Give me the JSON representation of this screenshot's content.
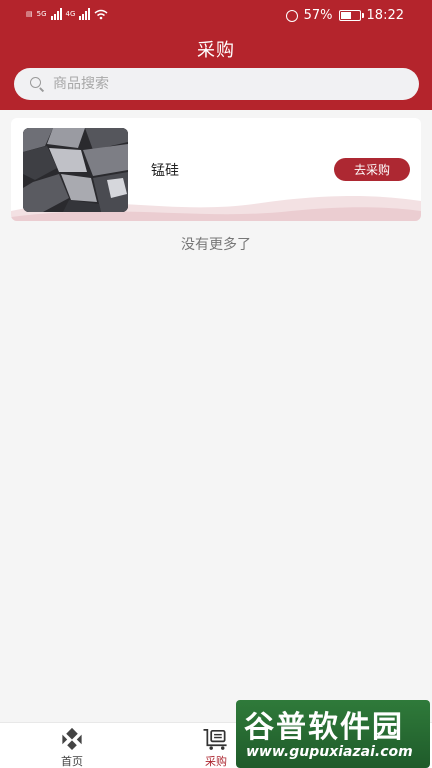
{
  "status_bar": {
    "network_tags": [
      "5G",
      "4G"
    ],
    "battery_percent": "57%",
    "battery_level": 0.57,
    "time": "18:22"
  },
  "header": {
    "title": "采购"
  },
  "search": {
    "placeholder": "商品搜索",
    "value": ""
  },
  "products": [
    {
      "name": "锰硅",
      "action_label": "去采购"
    }
  ],
  "list_footer": "没有更多了",
  "tabbar": {
    "items": [
      {
        "label": "首页",
        "icon": "home-icon",
        "active": false
      },
      {
        "label": "采购",
        "icon": "cart-icon",
        "active": true
      }
    ]
  },
  "watermark": {
    "title": "谷普软件园",
    "url": "www.gupuxiazai.com"
  },
  "colors": {
    "brand": "#b4242c",
    "button": "#ad2832",
    "background": "#f5f5f5"
  }
}
